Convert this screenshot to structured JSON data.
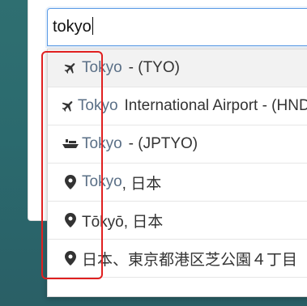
{
  "search": {
    "value": "tokyo"
  },
  "suggestions": [
    {
      "icon": "plane-icon",
      "match": "Tokyo",
      "rest": " - (TYO)"
    },
    {
      "icon": "plane-icon",
      "match": "Tokyo",
      "rest": " International Airport - (HND)"
    },
    {
      "icon": "ship-icon",
      "match": "Tokyo",
      "rest": " - (JPTYO)"
    },
    {
      "icon": "map-pin-icon",
      "match": "Tokyo",
      "rest": ", 日本"
    },
    {
      "icon": "map-pin-icon",
      "match": "",
      "rest": "Tōkyō, 日本"
    },
    {
      "icon": "map-pin-icon",
      "match": "",
      "rest": "日本、東京都港区芝公園４丁目"
    }
  ],
  "colors": {
    "match_text": "#5a6f86",
    "input_border": "#5b9be6",
    "highlight_border": "#e02020"
  }
}
